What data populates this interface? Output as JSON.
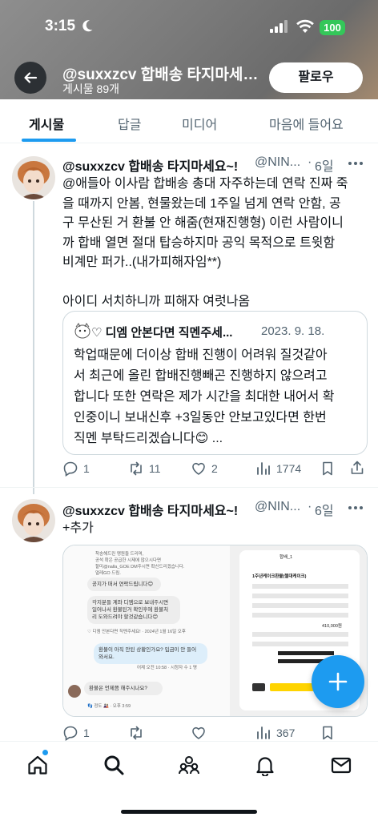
{
  "status_bar": {
    "time": "3:15",
    "battery": "100"
  },
  "header": {
    "title": "@suxxzcv 합배송 타지마세요~!",
    "post_count": "게시물 89개",
    "follow_label": "팔로우"
  },
  "tabs": [
    {
      "label": "게시물",
      "active": true
    },
    {
      "label": "답글"
    },
    {
      "label": "미디어"
    },
    {
      "label": "마음에 들어요"
    }
  ],
  "posts": [
    {
      "name": "@suxxzcv 합배송 타지마세요~!",
      "handle": "@NIN...",
      "time": "6일",
      "text": "@애들아 이사람 합배송 총대 자주하는데 연락 진짜 죽\n을 때까지 안봄, 현물왔는데 1주일 넘게 연락 안함, 공\n구 무산된 거 환불 안 해줌(현재진행형) 이런 사람이니\n까 합배 열면 절대 탑승하지마 공익 목적으로 트윗함\n비계만 퍼가..(내가피해자임**)\n\n아이디 서치하니까 피해자 여럿나옴",
      "quote": {
        "name": "♡ 디엠 안본다면 직멘주세...",
        "date": "2023. 9. 18.",
        "text": "학업때문에 더이상 합배 진행이 어려워 질것같아\n서 최근에 올린 합배진행빼곤 진행하지 않으려고\n합니다 또한 연락은 제가 시간을 최대한 내어서 확\n인중이니 보내신후 +3일동안 안보고있다면 한번\n직멘 부탁드리겠습니다😊 ..."
      },
      "actions": {
        "replies": "1",
        "reposts": "11",
        "likes": "2",
        "views": "1774"
      }
    },
    {
      "name": "@suxxzcv 합배송 타지마세요~!",
      "handle": "@NIN...",
      "time": "6일",
      "text": "+추가",
      "media": {
        "left_lines": [
          "착송해드린 맹원들 드리며,",
          "공석 확은 공급한 시제에 않으시다면",
          "할미@nalla_GOE DM주시면 확신드리겠습니다.",
          "멀레GO 드림."
        ],
        "bubble1": "공지가 떠서 연락드립니다😊",
        "bubble2": "각지분들 계좌 디엠으로 보내주시면\n일어나서 환불된거 확인후에 환불처\n리 도와드려야 할것같습니다😊",
        "meta1": "♡ 디엠 안본다면 직멘주세요! · 2024년 1월 16일 오후",
        "bubble3": "환불이 아직 안된 상황인가요? 입금이 안 들어\n와서요.",
        "meta2": "어제 오전 10:58 · 시청자 수 1 명",
        "bubble4": "환불은 언제쯤 해주시나요?",
        "meta3": "👣 정도 🎎 · 오후 3:59",
        "right_title": "합배_1",
        "right_heading": "1주년케이크환불(첼대케이크)",
        "right_amount": "410,000원"
      },
      "actions": {
        "replies": "1",
        "reposts": "",
        "likes": "",
        "views": "367"
      }
    }
  ],
  "icons": {
    "back": "arrow-left-icon",
    "more": "more-icon",
    "reply": "reply-icon",
    "repost": "repost-icon",
    "like": "heart-icon",
    "views": "views-icon",
    "bookmark": "bookmark-icon",
    "share": "share-icon",
    "compose": "plus-icon",
    "nav": [
      "home-icon",
      "search-icon",
      "communities-icon",
      "notifications-icon",
      "messages-icon"
    ]
  },
  "colors": {
    "accent": "#1d9bf0",
    "text": "#0f1419",
    "secondary": "#536471",
    "battery": "#34c759"
  }
}
